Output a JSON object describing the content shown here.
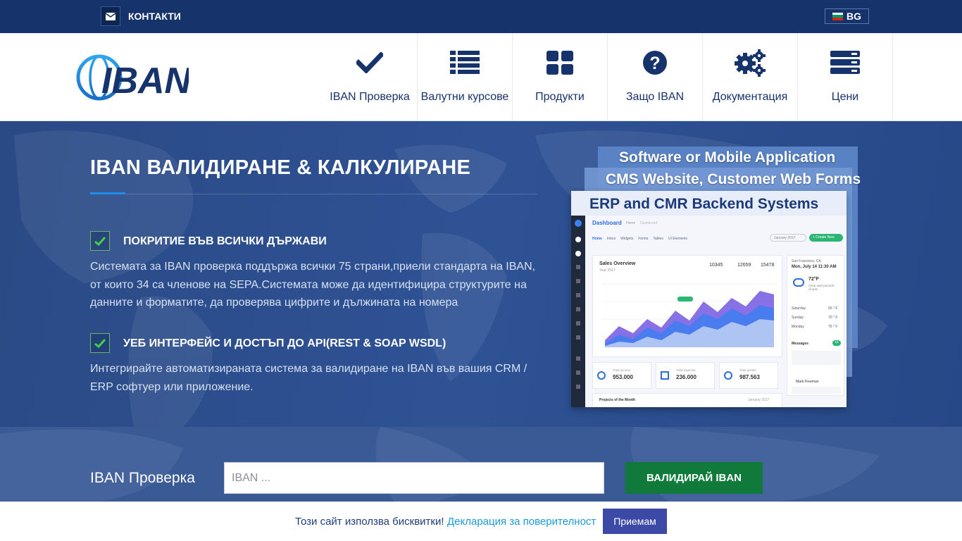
{
  "topbar": {
    "contact_label": "КОНТАКТИ",
    "language": "BG"
  },
  "header": {
    "logo_text": "IBAN",
    "nav": [
      {
        "label": "IBAN Проверка",
        "icon": "checkmark-icon"
      },
      {
        "label": "Валутни курсове",
        "icon": "list-icon"
      },
      {
        "label": "Продукти",
        "icon": "grid-icon"
      },
      {
        "label": "Защо IBAN",
        "icon": "question-circle-icon"
      },
      {
        "label": "Документация",
        "icon": "gears-icon"
      },
      {
        "label": "Цени",
        "icon": "server-icon"
      }
    ]
  },
  "hero": {
    "title": "IBAN ВАЛИДИРАНЕ & КАЛКУЛИРАНЕ",
    "features": [
      {
        "title": "ПОКРИТИЕ ВЪВ ВСИЧКИ ДЪРЖАВИ",
        "text": "Системата за IBAN проверка поддържа всички 75 страни,приели стандарта на IBAN, от които 34 са членове на SEPA.Системата може да идентифицира структурите на данните и форматите, да проверява цифрите и дължината на номера"
      },
      {
        "title": "УЕБ ИНТЕРФЕЙС И ДОСТЪП ДО API(REST & SOAP WSDL)",
        "text": "Интегрирайте автоматизираната система за валидиране на IBAN във вашия CRM / ERP софтуер или приложение."
      }
    ],
    "promo": {
      "captions": [
        "Software or Mobile Application",
        "CMS Website, Customer Web Forms",
        "ERP and CMR Backend Systems"
      ],
      "dashboard": {
        "title": "Dashboard",
        "crumb_home": "Home",
        "crumb_page": "Dashboard",
        "tabs": [
          "Home",
          "Inbox",
          "Widgets",
          "Forms",
          "Tables",
          "UI Elements"
        ],
        "date": "January 2017",
        "create_button": "+ Create New",
        "sales_title": "Sales Overview",
        "sales_sub": "Year 2017",
        "stats": [
          "10345",
          "12659",
          "15478"
        ],
        "city": "San Francisco, CA",
        "date_time": "Mon, July 14 11:30 AM",
        "temp": "72°F",
        "weather": "Clear with periodic clouds",
        "forecast": [
          {
            "day": "Saturday",
            "temp": "65 ° F"
          },
          {
            "day": "Sunday",
            "temp": "70 ° F"
          },
          {
            "day": "Monday",
            "temp": "75 ° F"
          }
        ],
        "messages": "Messages",
        "messages_count": "15",
        "sender": "Mark Freeman",
        "totals": [
          {
            "label": "Total income",
            "value": "953.000"
          },
          {
            "label": "Total expense",
            "value": "236.000"
          },
          {
            "label": "Total assets",
            "value": "987.563"
          }
        ],
        "projects": "Projects of the Month",
        "projects_date": "January 2017"
      }
    }
  },
  "search": {
    "label": "IBAN Проверка",
    "placeholder": "IBAN ...",
    "button": "ВАЛИДИРАЙ IBAN"
  },
  "cookie": {
    "text": "Този сайт използва бисквитки!",
    "link": "Декларация за поверителност",
    "button": "Приемам"
  },
  "colors": {
    "topbar": "#16336b",
    "brand": "#16336b",
    "accent": "#1f8ee6",
    "button_green": "#0f7a3a",
    "cookie_button": "#3d49a7"
  }
}
